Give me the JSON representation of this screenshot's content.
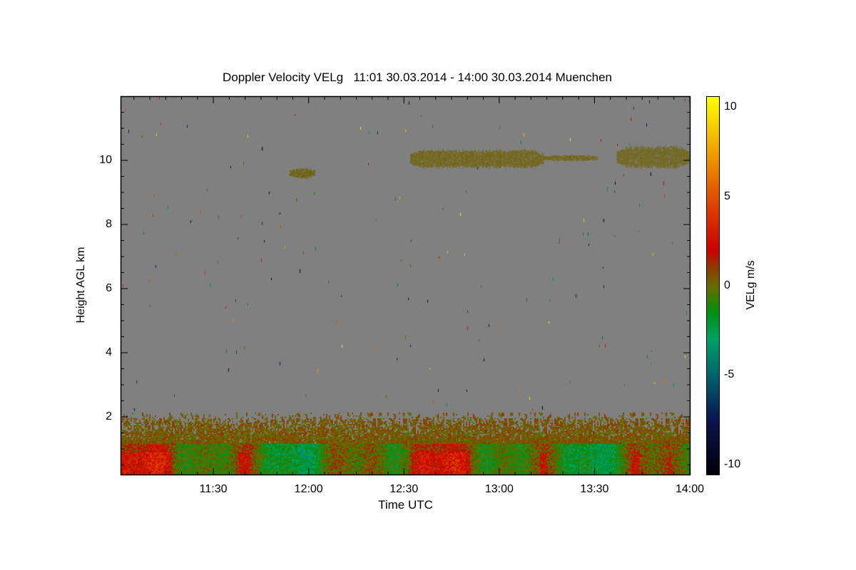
{
  "chart_data": {
    "type": "heatmap",
    "title": "Doppler Velocity VELg   11:01 30.03.2014 - 14:00 30.03.2014 Muenchen",
    "xlabel": "Time UTC",
    "ylabel": "Height AGL km",
    "x_range": [
      "11:01",
      "14:00"
    ],
    "x_ticks": [
      "11:30",
      "12:00",
      "12:30",
      "13:00",
      "13:30",
      "14:00"
    ],
    "y_range": [
      0.18,
      12.0
    ],
    "y_ticks": [
      2,
      4,
      6,
      8,
      10
    ],
    "background_color": "#808080",
    "colorbar": {
      "label": "VELg m/s",
      "range": [
        -10.6,
        10.6
      ],
      "ticks": [
        10,
        5,
        0,
        -5,
        -10
      ],
      "colormap": [
        [
          -10.6,
          "#000008"
        ],
        [
          -7.5,
          "#0a1450"
        ],
        [
          -5,
          "#00646e"
        ],
        [
          -3,
          "#00a064"
        ],
        [
          -1.5,
          "#009010"
        ],
        [
          0,
          "#6a6a00"
        ],
        [
          1,
          "#8c3c00"
        ],
        [
          2,
          "#cc0000"
        ],
        [
          5,
          "#e05000"
        ],
        [
          7.5,
          "#f0a000"
        ],
        [
          10.6,
          "#ffff00"
        ]
      ]
    },
    "features": [
      {
        "name": "boundary layer",
        "time": [
          "11:01",
          "14:00"
        ],
        "height_km": [
          0.18,
          2.0
        ],
        "velocity_ms": [
          -3,
          3
        ]
      },
      {
        "name": "cloud",
        "time": [
          "11:54",
          "12:02"
        ],
        "height_km": [
          9.45,
          9.75
        ],
        "velocity_ms": 0.2
      },
      {
        "name": "cloud",
        "time": [
          "12:32",
          "13:14"
        ],
        "height_km": [
          9.8,
          10.3
        ],
        "velocity_ms": 0.2
      },
      {
        "name": "cloud",
        "time": [
          "13:14",
          "13:31"
        ],
        "height_km": [
          10.0,
          10.15
        ],
        "velocity_ms": 0.2
      },
      {
        "name": "cloud",
        "time": [
          "13:37",
          "14:00"
        ],
        "height_km": [
          9.8,
          10.4
        ],
        "velocity_ms": 0.2
      }
    ]
  }
}
